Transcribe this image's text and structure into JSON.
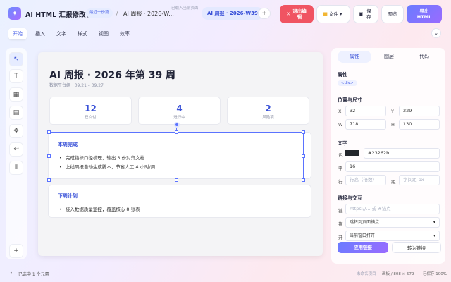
{
  "app": {
    "title": "AI HTML 汇报修改台",
    "recent_label": "最近一份篇"
  },
  "breadcrumb": {
    "sep": "/",
    "doc": "AI 周报 · 2026-W..."
  },
  "hint": "已载入当前页面",
  "tab": {
    "label": "AI 周报 · 2026-W39",
    "plus": "+"
  },
  "toolbar": {
    "exit": "退出编辑",
    "file": "文件",
    "save": "保存",
    "preview": "预览",
    "export": "导出 HTML"
  },
  "ribbon": {
    "tabs": [
      "开始",
      "插入",
      "文字",
      "样式",
      "视图",
      "效率"
    ],
    "collapse": "⌄"
  },
  "tools": [
    "↖",
    "T",
    "▦",
    "▤",
    "✥",
    "↩",
    "⦀",
    "+"
  ],
  "doc": {
    "title": "AI 周报 · 2026 年第 39 周",
    "subtitle": "数据平台组 · 09.21 – 09.27",
    "stats": [
      {
        "num": "12",
        "label": "已交付"
      },
      {
        "num": "4",
        "label": "进行中"
      },
      {
        "num": "2",
        "label": "风险项"
      }
    ],
    "card1": {
      "title": "本周完成",
      "items": [
        "完成指标口径梳理，输出 3 份对齐文档",
        "上线周报自动生成脚本，节省人工 4 小时/周"
      ]
    },
    "card2": {
      "title": "下周计划",
      "items": [
        "接入数据质量监控，覆盖核心 8 张表"
      ]
    }
  },
  "panel": {
    "tabs": [
      "属性",
      "图层",
      "代码"
    ],
    "attr_title": "属性",
    "tag": "<div>",
    "pos_title": "位置与尺寸",
    "x_label": "X",
    "x": "32",
    "y_label": "Y",
    "y": "229",
    "w_label": "W",
    "w": "718",
    "h_label": "H",
    "h": "130",
    "text_title": "文字",
    "color_label": "色",
    "color": "#23262b",
    "size_label": "字",
    "size": "16",
    "lh_label": "行",
    "lh_ph": "行高（倍数）",
    "ls_label": "距",
    "ls_ph": "字间距 px",
    "link_title": "链接与交互",
    "link_label": "链",
    "link_ph": "https://... 或 #锚点",
    "anchor_label": "锚",
    "anchor": "跳转到页面锚点...",
    "open_label": "开",
    "open": "当前窗口打开",
    "apply": "应用链接",
    "convert": "转为链接"
  },
  "status": {
    "left": "已选中 1 个元素",
    "unsaved": "未命名项目",
    "canvas": "画板 / 808 × 579",
    "zoom": "已保存 100%"
  }
}
